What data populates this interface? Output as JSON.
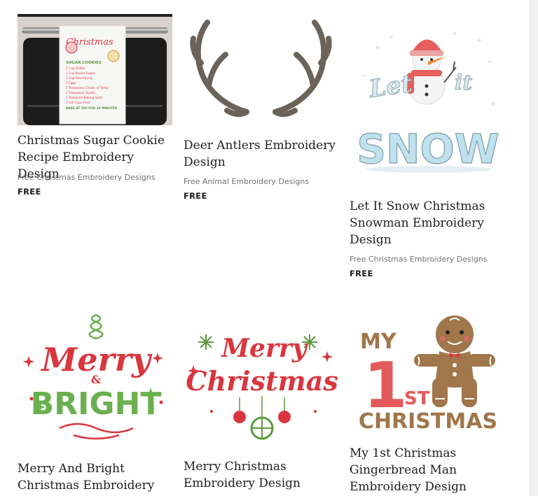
{
  "products": [
    {
      "title_lines": [
        "Christmas Sugar Cookie",
        "Recipe Embroidery Design"
      ],
      "category": "Free Christmas Embroidery Designs",
      "price": "FREE",
      "towel": {
        "script": "Christmas",
        "heading": "SUGAR COOKIES",
        "lines": [
          "1 Cup Butter",
          "1 Cup Brown Sugar",
          "1 Cup Shortening",
          "2 Eggs",
          "2 Teaspoons Cream of Tartar",
          "2 Teaspoons Vanilla",
          "1 Teaspoon Baking Soda",
          "3 1/4 Cups Flour"
        ],
        "footer": "BAKE AT 350 FOR 10 MINUTES"
      }
    },
    {
      "title_lines": [
        "Deer Antlers Embroidery",
        "Design"
      ],
      "category": "Free Animal Embroidery Designs",
      "price": "FREE"
    },
    {
      "title_lines": [
        "Let It Snow Christmas",
        "Snowman Embroidery",
        "Design"
      ],
      "category": "Free Christmas Embroidery Designs",
      "price": "FREE",
      "art": {
        "word1": "Let",
        "word2": "it",
        "word3": "SNOW"
      }
    },
    {
      "title_lines": [
        "Merry And Bright",
        "Christmas Embroidery"
      ],
      "art": {
        "word1": "Merry",
        "amp": "&",
        "word2": "BRIGHT"
      }
    },
    {
      "title_lines": [
        "Merry Christmas",
        "Embroidery Design"
      ],
      "art": {
        "word1": "Merry",
        "word2": "Christmas"
      }
    },
    {
      "title_lines": [
        "My 1st Christmas",
        "Gingerbread Man",
        "Embroidery Design"
      ],
      "art": {
        "my": "MY",
        "one": "1",
        "st": "ST",
        "xmas": "CHRISTMAS"
      }
    }
  ],
  "colors": {
    "title": "#1f1f1f",
    "category": "#707070",
    "christmas_red": "#d9363e",
    "christmas_green": "#6bb04f",
    "antler": "#6b6259",
    "snow_blue": "#bfe2ee",
    "gingerbread": "#a0764a"
  }
}
